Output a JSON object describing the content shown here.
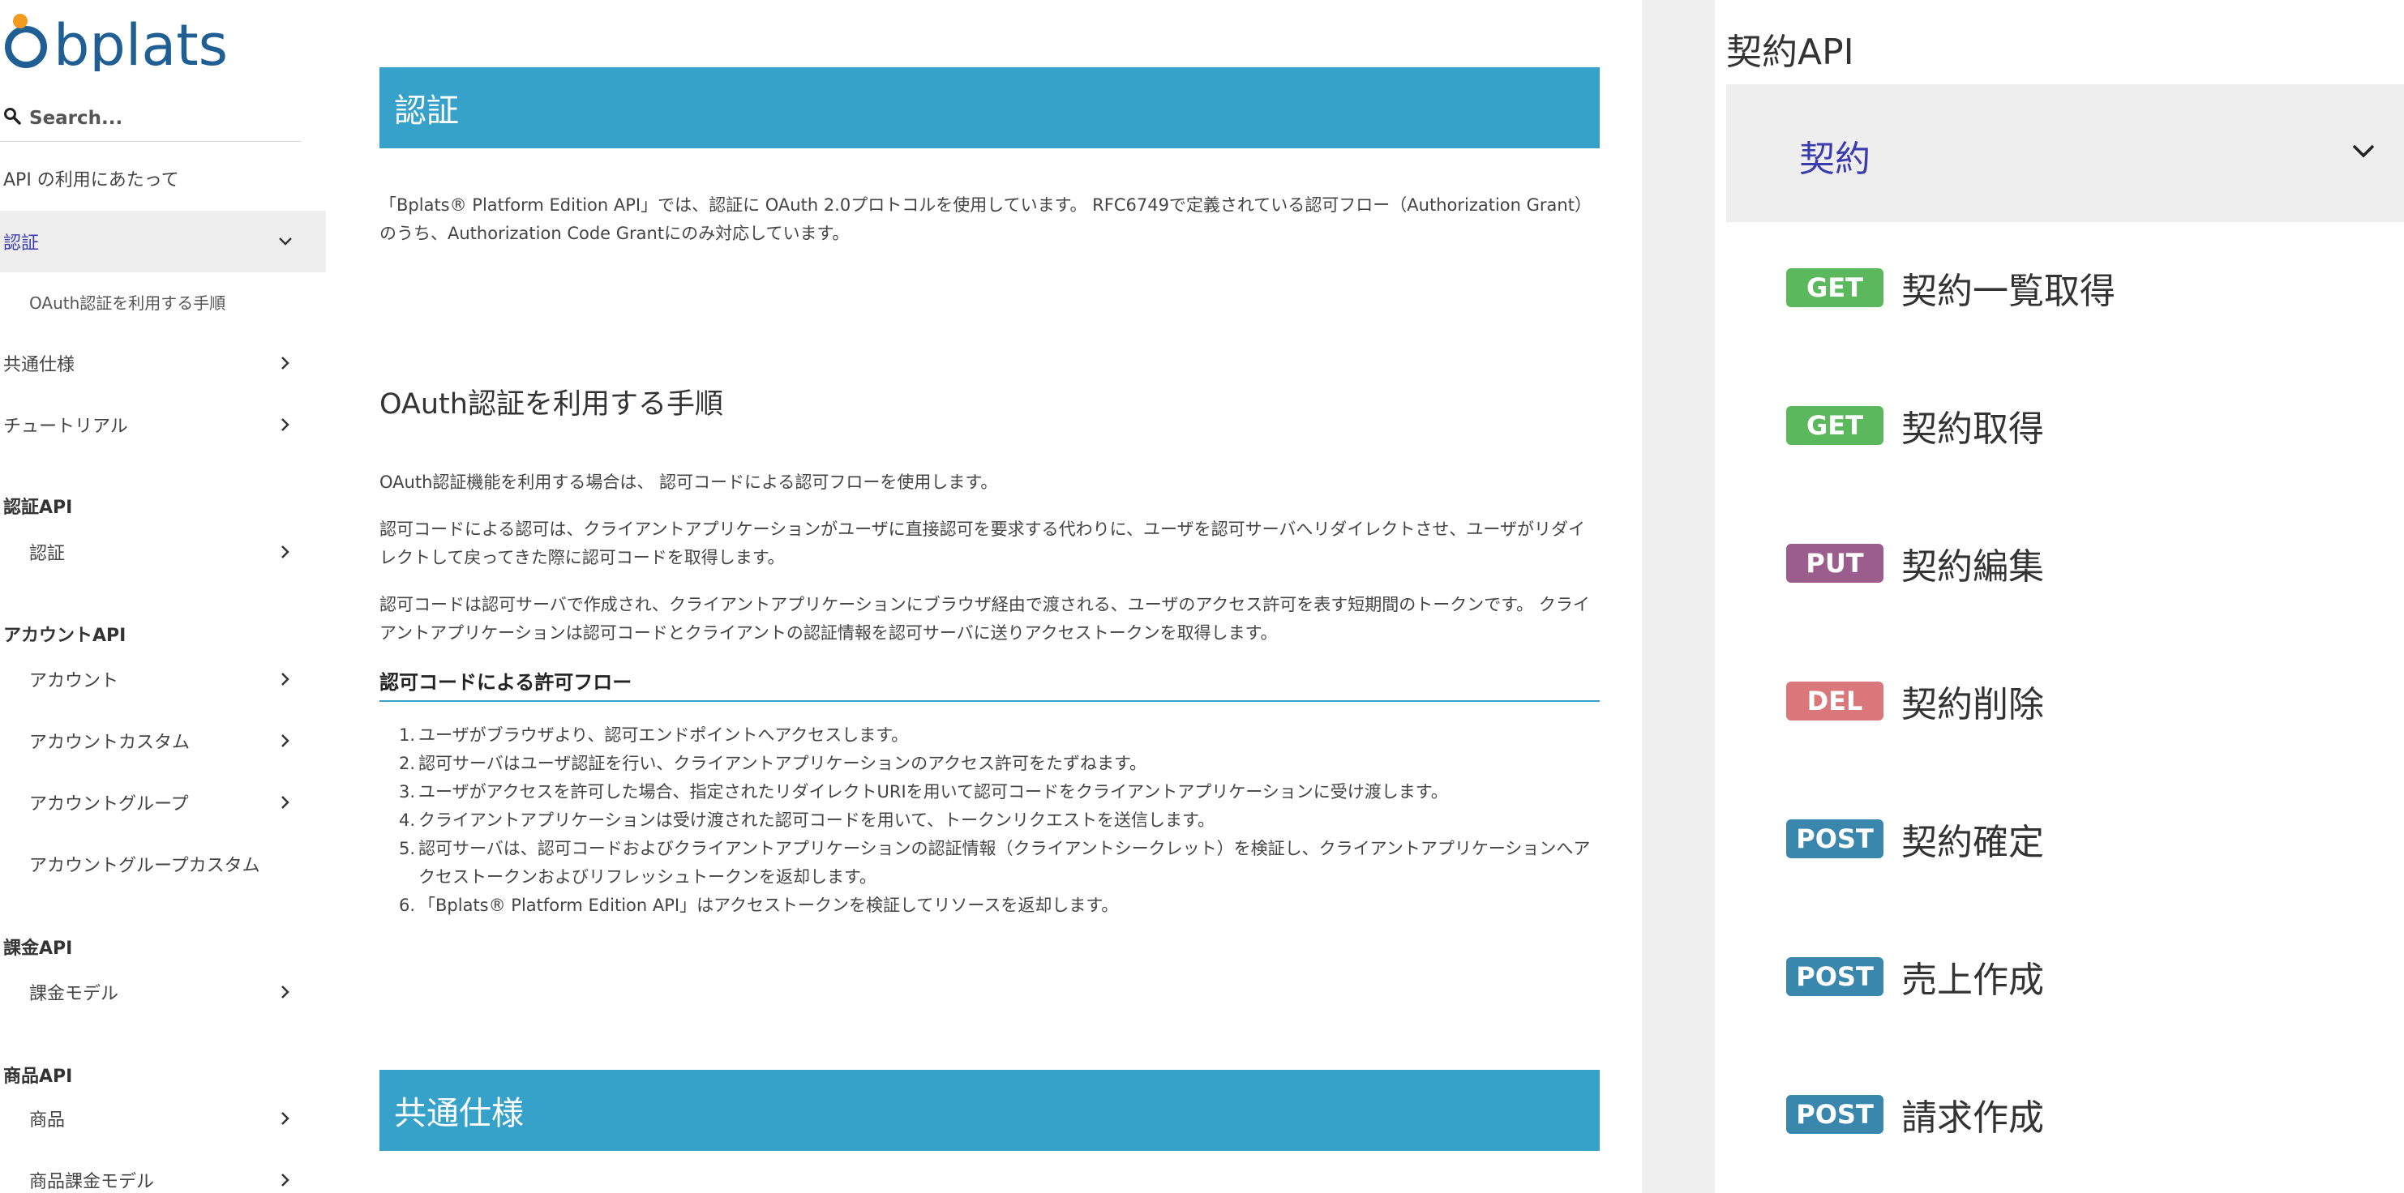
{
  "logo": {
    "text": "bplats"
  },
  "search": {
    "placeholder": "Search..."
  },
  "sidebar": {
    "items": [
      {
        "label": "API の利用にあたって",
        "type": "item"
      },
      {
        "label": "認証",
        "type": "item-active"
      },
      {
        "label": "OAuth認証を利用する手順",
        "type": "sub"
      },
      {
        "label": "共通仕様",
        "type": "item"
      },
      {
        "label": "チュートリアル",
        "type": "item"
      },
      {
        "label": "認証API",
        "type": "heading"
      },
      {
        "label": "認証",
        "type": "sub"
      },
      {
        "label": "アカウントAPI",
        "type": "heading"
      },
      {
        "label": "アカウント",
        "type": "sub"
      },
      {
        "label": "アカウントカスタム",
        "type": "sub"
      },
      {
        "label": "アカウントグループ",
        "type": "sub"
      },
      {
        "label": "アカウントグループカスタム",
        "type": "sub"
      },
      {
        "label": "課金API",
        "type": "heading"
      },
      {
        "label": "課金モデル",
        "type": "sub"
      },
      {
        "label": "商品API",
        "type": "heading"
      },
      {
        "label": "商品",
        "type": "sub"
      },
      {
        "label": "商品課金モデル",
        "type": "sub"
      }
    ]
  },
  "main": {
    "banner1": "認証",
    "intro": "「Bplats® Platform Edition API」では、認証に OAuth 2.0プロトコルを使用しています。 RFC6749で定義されている認可フロー（Authorization Grant）のうち、Authorization Code Grantにのみ対応しています。",
    "oauth_heading": "OAuth認証を利用する手順",
    "p1": "OAuth認証機能を利用する場合は、 認可コードによる認可フローを使用します。",
    "p2": "認可コードによる認可は、クライアントアプリケーションがユーザに直接認可を要求する代わりに、ユーザを認可サーバへリダイレクトさせ、ユーザがリダイレクトして戻ってきた際に認可コードを取得します。",
    "p3": "認可コードは認可サーバで作成され、クライアントアプリケーションにブラウザ経由で渡される、ユーザのアクセス許可を表す短期間のトークンです。 クライアントアプリケーションは認可コードとクライアントの認証情報を認可サーバに送りアクセストークンを取得します。",
    "flow_heading": "認可コードによる許可フロー",
    "flow_steps": [
      "ユーザがブラウザより、認可エンドポイントへアクセスします。",
      "認可サーバはユーザ認証を行い、クライアントアプリケーションのアクセス許可をたずねます。",
      "ユーザがアクセスを許可した場合、指定されたリダイレクトURIを用いて認可コードをクライアントアプリケーションに受け渡します。",
      "クライアントアプリケーションは受け渡された認可コードを用いて、トークンリクエストを送信します。",
      "認可サーバは、認可コードおよびクライアントアプリケーションの認証情報（クライアントシークレット）を検証し、クライアントアプリケーションへアクセストークンおよびリフレッシュトークンを返却します。",
      "「Bplats® Platform Edition API」はアクセストークンを検証してリソースを返却します。"
    ],
    "banner2": "共通仕様"
  },
  "right": {
    "title": "契約API",
    "group": "契約",
    "endpoints": [
      {
        "method": "GET",
        "name": "契約一覧取得",
        "color": "#5cb85c"
      },
      {
        "method": "GET",
        "name": "契約取得",
        "color": "#5cb85c"
      },
      {
        "method": "PUT",
        "name": "契約編集",
        "color": "#9b5e8c"
      },
      {
        "method": "DEL",
        "name": "契約削除",
        "color": "#d9777a"
      },
      {
        "method": "POST",
        "name": "契約確定",
        "color": "#3a87ad"
      },
      {
        "method": "POST",
        "name": "売上作成",
        "color": "#3a87ad"
      },
      {
        "method": "POST",
        "name": "請求作成",
        "color": "#3a87ad"
      }
    ]
  },
  "colors": {
    "accent": "#36a2ca",
    "active_text": "#3b3bb0"
  }
}
